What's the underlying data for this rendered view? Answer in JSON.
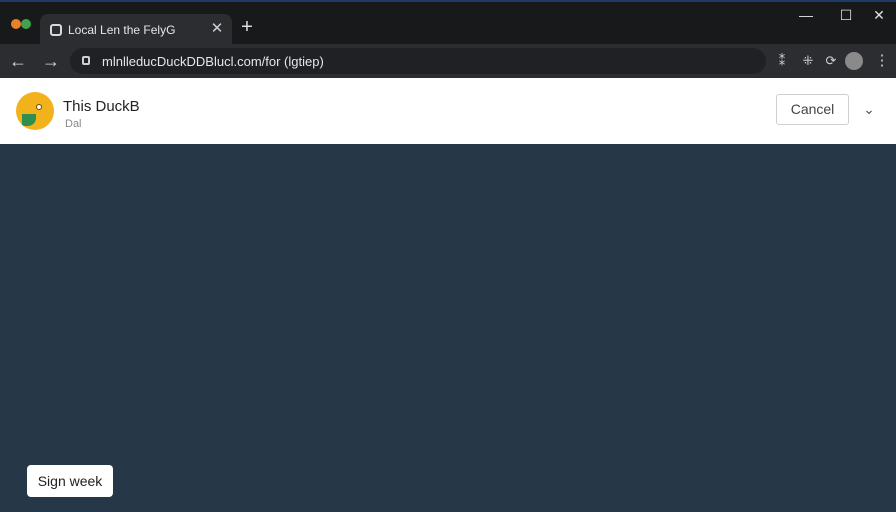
{
  "browser": {
    "tab": {
      "title": "Local Len the FelyG",
      "close_glyph": "✕"
    },
    "new_tab_glyph": "+",
    "window_controls": {
      "minimize": "—",
      "maximize": "☐",
      "close": "✕"
    },
    "nav": {
      "back": "←",
      "forward": "→"
    },
    "address": {
      "url": "mlnlleducDuckDDBlucl.com/for (lgtiep)"
    },
    "extensions": [
      "⁑",
      "⁜",
      "⟳"
    ]
  },
  "app": {
    "title": "This DuckB",
    "subtitle": "Dal",
    "cancel_label": "Cancel",
    "chevron_glyph": "⌄"
  },
  "content": {
    "sign_button_label": "Sign week"
  }
}
